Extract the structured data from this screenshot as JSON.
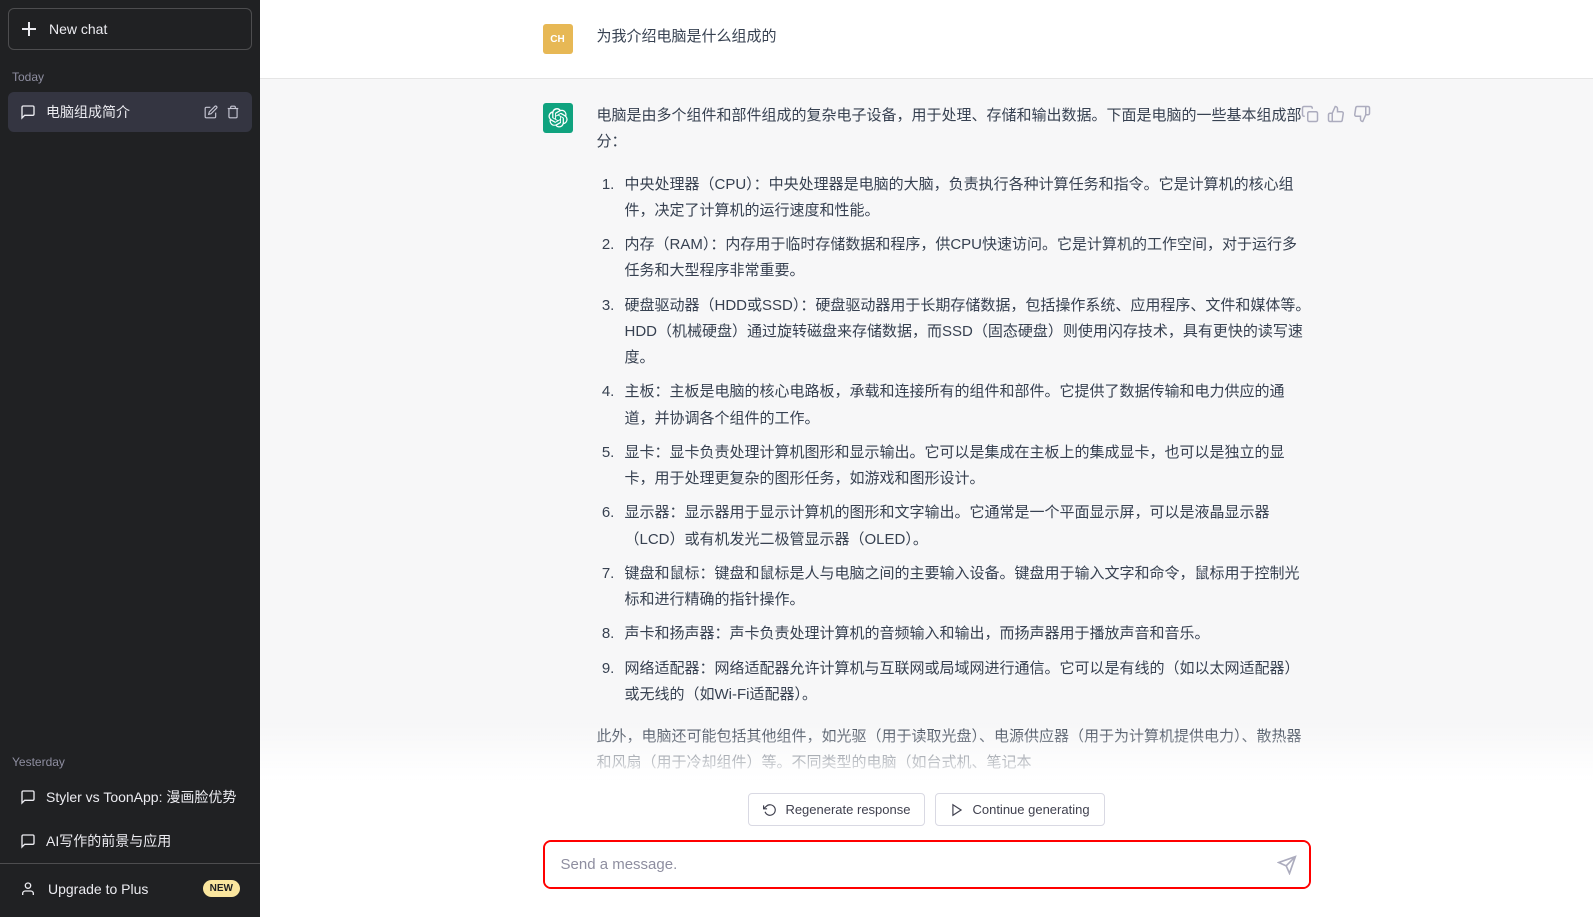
{
  "sidebar": {
    "new_chat_label": "New chat",
    "today_label": "Today",
    "yesterday_label": "Yesterday",
    "today_items": [
      {
        "title": "电脑组成简介",
        "active": true
      }
    ],
    "yesterday_items": [
      {
        "title": "Styler vs ToonApp: 漫画脸优势"
      },
      {
        "title": "AI写作的前景与应用"
      }
    ],
    "upgrade_label": "Upgrade to Plus",
    "new_badge": "NEW"
  },
  "chat": {
    "user_avatar_text": "CH",
    "user_message": "为我介绍电脑是什么组成的",
    "assistant_intro": "电脑是由多个组件和部件组成的复杂电子设备，用于处理、存储和输出数据。下面是电脑的一些基本组成部分：",
    "assistant_list": [
      "中央处理器（CPU）：中央处理器是电脑的大脑，负责执行各种计算任务和指令。它是计算机的核心组件，决定了计算机的运行速度和性能。",
      "内存（RAM）：内存用于临时存储数据和程序，供CPU快速访问。它是计算机的工作空间，对于运行多任务和大型程序非常重要。",
      "硬盘驱动器（HDD或SSD）：硬盘驱动器用于长期存储数据，包括操作系统、应用程序、文件和媒体等。HDD（机械硬盘）通过旋转磁盘来存储数据，而SSD（固态硬盘）则使用闪存技术，具有更快的读写速度。",
      "主板：主板是电脑的核心电路板，承载和连接所有的组件和部件。它提供了数据传输和电力供应的通道，并协调各个组件的工作。",
      "显卡：显卡负责处理计算机图形和显示输出。它可以是集成在主板上的集成显卡，也可以是独立的显卡，用于处理更复杂的图形任务，如游戏和图形设计。",
      "显示器：显示器用于显示计算机的图形和文字输出。它通常是一个平面显示屏，可以是液晶显示器（LCD）或有机发光二极管显示器（OLED）。",
      "键盘和鼠标：键盘和鼠标是人与电脑之间的主要输入设备。键盘用于输入文字和命令，鼠标用于控制光标和进行精确的指针操作。",
      "声卡和扬声器：声卡负责处理计算机的音频输入和输出，而扬声器用于播放声音和音乐。",
      "网络适配器：网络适配器允许计算机与互联网或局域网进行通信。它可以是有线的（如以太网适配器）或无线的（如Wi-Fi适配器）。"
    ],
    "assistant_outro": "此外，电脑还可能包括其他组件，如光驱（用于读取光盘）、电源供应器（用于为计算机提供电力）、散热器和风扇（用于冷却组件）等。不同类型的电脑（如台式机、笔记本"
  },
  "footer": {
    "regenerate_label": "Regenerate response",
    "continue_label": "Continue generating",
    "input_placeholder": "Send a message."
  }
}
